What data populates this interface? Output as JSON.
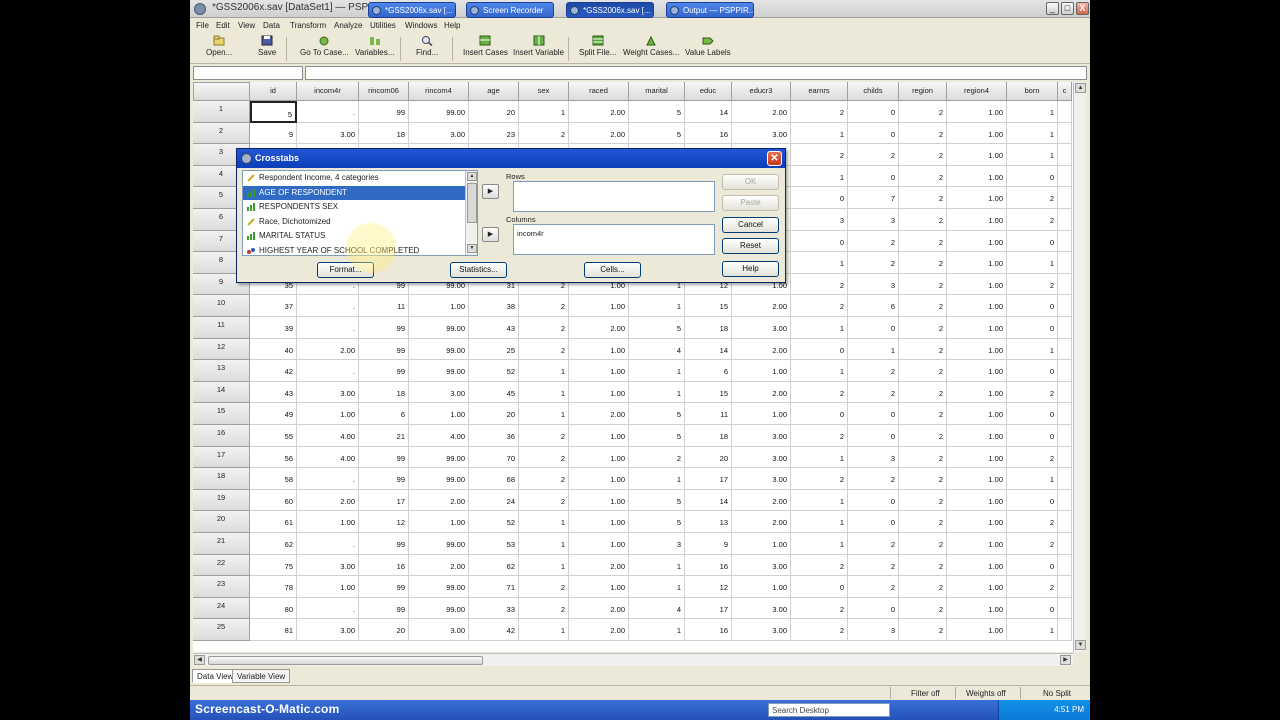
{
  "window": {
    "title": "*GSS2006x.sav [DataSet1] — PSPPIRE Data Editor",
    "controls": [
      "_",
      "□",
      "X"
    ]
  },
  "menubar": [
    "File",
    "Edit",
    "View",
    "Data",
    "Transform",
    "Analyze",
    "Utilities",
    "Windows",
    "Help"
  ],
  "toolbar": [
    {
      "label": "Open...",
      "icon": "open-icon"
    },
    {
      "label": "Save",
      "icon": "save-icon"
    },
    {
      "label": "Go To Case...",
      "icon": "goto-case-icon"
    },
    {
      "label": "Variables...",
      "icon": "variables-icon"
    },
    {
      "label": "Find...",
      "icon": "find-icon"
    },
    {
      "label": "Insert Cases",
      "icon": "insert-cases-icon"
    },
    {
      "label": "Insert Variable",
      "icon": "insert-variable-icon"
    },
    {
      "label": "Split File...",
      "icon": "split-file-icon"
    },
    {
      "label": "Weight Cases...",
      "icon": "weight-cases-icon"
    },
    {
      "label": "Value Labels",
      "icon": "value-labels-icon"
    }
  ],
  "grid": {
    "columns": [
      "id",
      "incom4r",
      "rincom06",
      "rincom4",
      "age",
      "sex",
      "raced",
      "marital",
      "educ",
      "educr3",
      "earnrs",
      "childs",
      "region",
      "region4",
      "born",
      "c"
    ],
    "rows": [
      {
        "n": "1",
        "cells": [
          "5",
          ".",
          "99",
          "99.00",
          "20",
          "1",
          "2.00",
          "5",
          "14",
          "2.00",
          "2",
          "0",
          "2",
          "1.00",
          "1"
        ]
      },
      {
        "n": "2",
        "cells": [
          "9",
          "3.00",
          "18",
          "3.00",
          "23",
          "2",
          "2.00",
          "5",
          "16",
          "3.00",
          "1",
          "0",
          "2",
          "1.00",
          "1"
        ]
      },
      {
        "n": "3",
        "cells": [
          "",
          "",
          "",
          "",
          "",
          "",
          "",
          "",
          "",
          "",
          "2",
          "2",
          "2",
          "1.00",
          "1"
        ]
      },
      {
        "n": "4",
        "cells": [
          "",
          "",
          "",
          "",
          "",
          "",
          "",
          "",
          "",
          "",
          "1",
          "0",
          "2",
          "1.00",
          "0"
        ]
      },
      {
        "n": "5",
        "cells": [
          "",
          "",
          "",
          "",
          "",
          "",
          "",
          "",
          "",
          "",
          "0",
          "7",
          "2",
          "1.00",
          "2"
        ]
      },
      {
        "n": "6",
        "cells": [
          "",
          "",
          "",
          "",
          "",
          "",
          "",
          "",
          "",
          "",
          "3",
          "3",
          "2",
          "1.00",
          "2"
        ]
      },
      {
        "n": "7",
        "cells": [
          "",
          "",
          "",
          "",
          "",
          "",
          "",
          "",
          "",
          "",
          "0",
          "2",
          "2",
          "1.00",
          "0"
        ]
      },
      {
        "n": "8",
        "cells": [
          "",
          "",
          "",
          "",
          "",
          "",
          "",
          "",
          "",
          "",
          "1",
          "2",
          "2",
          "1.00",
          "1"
        ]
      },
      {
        "n": "9",
        "cells": [
          "35",
          ".",
          "99",
          "99.00",
          "31",
          "2",
          "1.00",
          "1",
          "12",
          "1.00",
          "2",
          "3",
          "2",
          "1.00",
          "2"
        ]
      },
      {
        "n": "10",
        "cells": [
          "37",
          ".",
          "11",
          "1.00",
          "38",
          "2",
          "1.00",
          "1",
          "15",
          "2.00",
          "2",
          "6",
          "2",
          "1.00",
          "0"
        ]
      },
      {
        "n": "11",
        "cells": [
          "39",
          ".",
          "99",
          "99.00",
          "43",
          "2",
          "2.00",
          "5",
          "18",
          "3.00",
          "1",
          "0",
          "2",
          "1.00",
          "0"
        ]
      },
      {
        "n": "12",
        "cells": [
          "40",
          "2.00",
          "99",
          "99.00",
          "25",
          "2",
          "1.00",
          "4",
          "14",
          "2.00",
          "0",
          "1",
          "2",
          "1.00",
          "1"
        ]
      },
      {
        "n": "13",
        "cells": [
          "42",
          ".",
          "99",
          "99.00",
          "52",
          "1",
          "1.00",
          "1",
          "6",
          "1.00",
          "1",
          "2",
          "2",
          "1.00",
          "0"
        ]
      },
      {
        "n": "14",
        "cells": [
          "43",
          "3.00",
          "18",
          "3.00",
          "45",
          "1",
          "1.00",
          "1",
          "15",
          "2.00",
          "2",
          "2",
          "2",
          "1.00",
          "2"
        ]
      },
      {
        "n": "15",
        "cells": [
          "49",
          "1.00",
          "6",
          "1.00",
          "20",
          "1",
          "2.00",
          "5",
          "11",
          "1.00",
          "0",
          "0",
          "2",
          "1.00",
          "0"
        ]
      },
      {
        "n": "16",
        "cells": [
          "55",
          "4.00",
          "21",
          "4.00",
          "36",
          "2",
          "1.00",
          "5",
          "18",
          "3.00",
          "2",
          "0",
          "2",
          "1.00",
          "0"
        ]
      },
      {
        "n": "17",
        "cells": [
          "56",
          "4.00",
          "99",
          "99.00",
          "70",
          "2",
          "1.00",
          "2",
          "20",
          "3.00",
          "1",
          "3",
          "2",
          "1.00",
          "2"
        ]
      },
      {
        "n": "18",
        "cells": [
          "58",
          ".",
          "99",
          "99.00",
          "68",
          "2",
          "1.00",
          "1",
          "17",
          "3.00",
          "2",
          "2",
          "2",
          "1.00",
          "1"
        ]
      },
      {
        "n": "19",
        "cells": [
          "60",
          "2.00",
          "17",
          "2.00",
          "24",
          "2",
          "1.00",
          "5",
          "14",
          "2.00",
          "1",
          "0",
          "2",
          "1.00",
          "0"
        ]
      },
      {
        "n": "20",
        "cells": [
          "61",
          "1.00",
          "12",
          "1.00",
          "52",
          "1",
          "1.00",
          "5",
          "13",
          "2.00",
          "1",
          "0",
          "2",
          "1.00",
          "2"
        ]
      },
      {
        "n": "21",
        "cells": [
          "62",
          ".",
          "99",
          "99.00",
          "53",
          "1",
          "1.00",
          "3",
          "9",
          "1.00",
          "1",
          "2",
          "2",
          "1.00",
          "2"
        ]
      },
      {
        "n": "22",
        "cells": [
          "75",
          "3.00",
          "16",
          "2.00",
          "62",
          "1",
          "2.00",
          "1",
          "16",
          "3.00",
          "2",
          "2",
          "2",
          "1.00",
          "0"
        ]
      },
      {
        "n": "23",
        "cells": [
          "78",
          "1.00",
          "99",
          "99.00",
          "71",
          "2",
          "1.00",
          "1",
          "12",
          "1.00",
          "0",
          "2",
          "2",
          "1.00",
          "2"
        ]
      },
      {
        "n": "24",
        "cells": [
          "80",
          ".",
          "99",
          "99.00",
          "33",
          "2",
          "2.00",
          "4",
          "17",
          "3.00",
          "2",
          "0",
          "2",
          "1.00",
          "0"
        ]
      },
      {
        "n": "25",
        "cells": [
          "81",
          "3.00",
          "20",
          "3.00",
          "42",
          "1",
          "2.00",
          "1",
          "16",
          "3.00",
          "2",
          "3",
          "2",
          "1.00",
          "1"
        ]
      }
    ]
  },
  "tabs": [
    "Data View",
    "Variable View"
  ],
  "status": {
    "filter": "Filter off",
    "weights": "Weights off",
    "split": "No Split"
  },
  "dialog": {
    "title": "Crosstabs",
    "variables": [
      {
        "label": "Respondent Income, 4 categories",
        "icon": "scale-ruler-icon"
      },
      {
        "label": "AGE OF RESPONDENT",
        "icon": "bar-chart-icon"
      },
      {
        "label": "RESPONDENTS SEX",
        "icon": "bar-chart-icon"
      },
      {
        "label": "Race, Dichotomized",
        "icon": "scale-ruler-icon"
      },
      {
        "label": "MARITAL STATUS",
        "icon": "bar-chart-icon"
      },
      {
        "label": "HIGHEST YEAR OF SCHOOL COMPLETED",
        "icon": "nominal-icon"
      }
    ],
    "rows_label": "Rows",
    "columns_label": "Columns",
    "columns_value": "incom4r",
    "buttons": {
      "ok": "OK",
      "paste": "Paste",
      "cancel": "Cancel",
      "reset": "Reset",
      "help": "Help"
    },
    "bottom_buttons": {
      "format": "Format...",
      "statistics": "Statistics...",
      "cells": "Cells..."
    }
  },
  "taskbar": {
    "watermark": "Screencast-O-Matic.com",
    "tasks": [
      "*GSS2006x.sav [...",
      "Screen Recorder",
      "*GSS2006x.sav [...",
      "Output — PSPPIR..."
    ],
    "search_placeholder": "Search Desktop",
    "clock": "4:51 PM"
  },
  "colors": {
    "selection": "#316ac5",
    "dialog_title": "#0a3fb8",
    "taskbar": "#2451b8"
  }
}
